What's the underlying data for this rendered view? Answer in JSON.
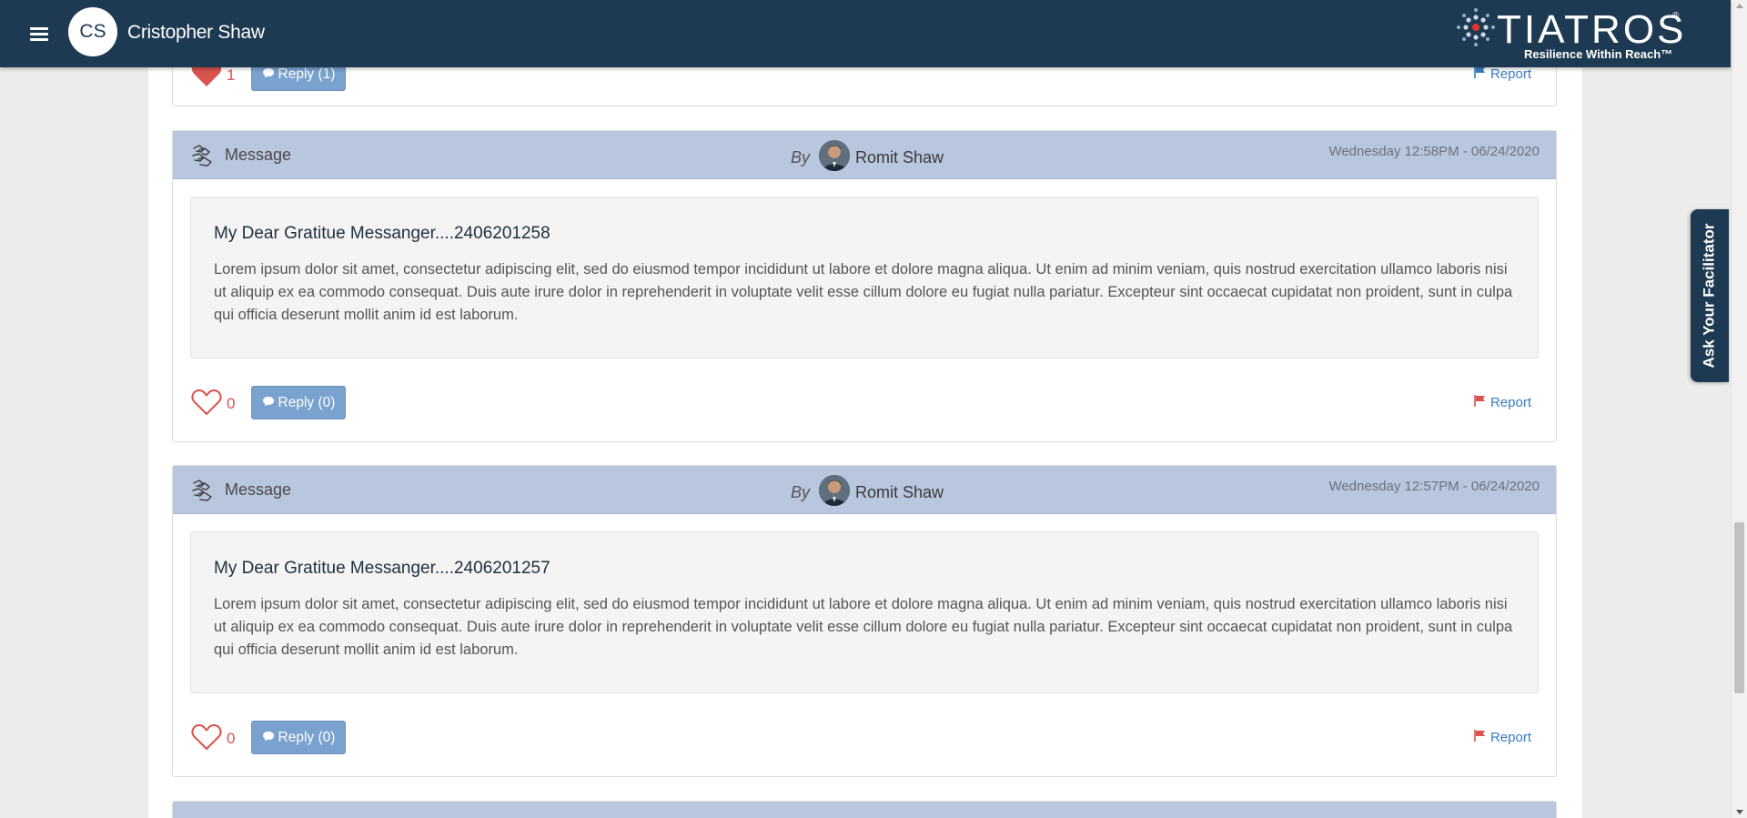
{
  "header": {
    "user_initials": "CS",
    "user_name": "Cristopher Shaw",
    "logo_text": "TIATROS",
    "logo_registered": "®",
    "logo_tagline": "Resilience Within Reach™",
    "menu_icon": "hamburger-menu-icon"
  },
  "partial_top_card": {
    "like_count": "1",
    "reply_label": "Reply (1)",
    "report_label": "Report"
  },
  "messages": [
    {
      "type_label": "Message",
      "by_label": "By",
      "author": "Romit Shaw",
      "timestamp": "Wednesday 12:58PM - 06/24/2020",
      "title": "My Dear Gratitue Messanger....2406201258",
      "body": "Lorem ipsum dolor sit amet, consectetur adipiscing elit, sed do eiusmod tempor incididunt ut labore et dolore magna aliqua. Ut enim ad minim veniam, quis nostrud exercitation ullamco laboris nisi ut aliquip ex ea commodo consequat. Duis aute irure dolor in reprehenderit in voluptate velit esse cillum dolore eu fugiat nulla pariatur. Excepteur sint occaecat cupidatat non proident, sunt in culpa qui officia deserunt mollit anim id est laborum.",
      "like_count": "0",
      "reply_label": "Reply (0)",
      "report_label": "Report"
    },
    {
      "type_label": "Message",
      "by_label": "By",
      "author": "Romit Shaw",
      "timestamp": "Wednesday 12:57PM - 06/24/2020",
      "title": "My Dear Gratitue Messanger....2406201257",
      "body": "Lorem ipsum dolor sit amet, consectetur adipiscing elit, sed do eiusmod tempor incididunt ut labore et dolore magna aliqua. Ut enim ad minim veniam, quis nostrud exercitation ullamco laboris nisi ut aliquip ex ea commodo consequat. Duis aute irure dolor in reprehenderit in voluptate velit esse cillum dolore eu fugiat nulla pariatur. Excepteur sint occaecat cupidatat non proident, sunt in culpa qui officia deserunt mollit anim id est laborum.",
      "like_count": "0",
      "reply_label": "Reply (0)",
      "report_label": "Report"
    }
  ],
  "facilitator_tab": {
    "label": "Ask Your Facilitator"
  },
  "colors": {
    "header_bg": "#1e3a52",
    "card_head_bg": "#b8c6de",
    "reply_button_bg": "#7aa2cf",
    "heart_red": "#d9534f",
    "report_link": "#3a7dc0"
  }
}
